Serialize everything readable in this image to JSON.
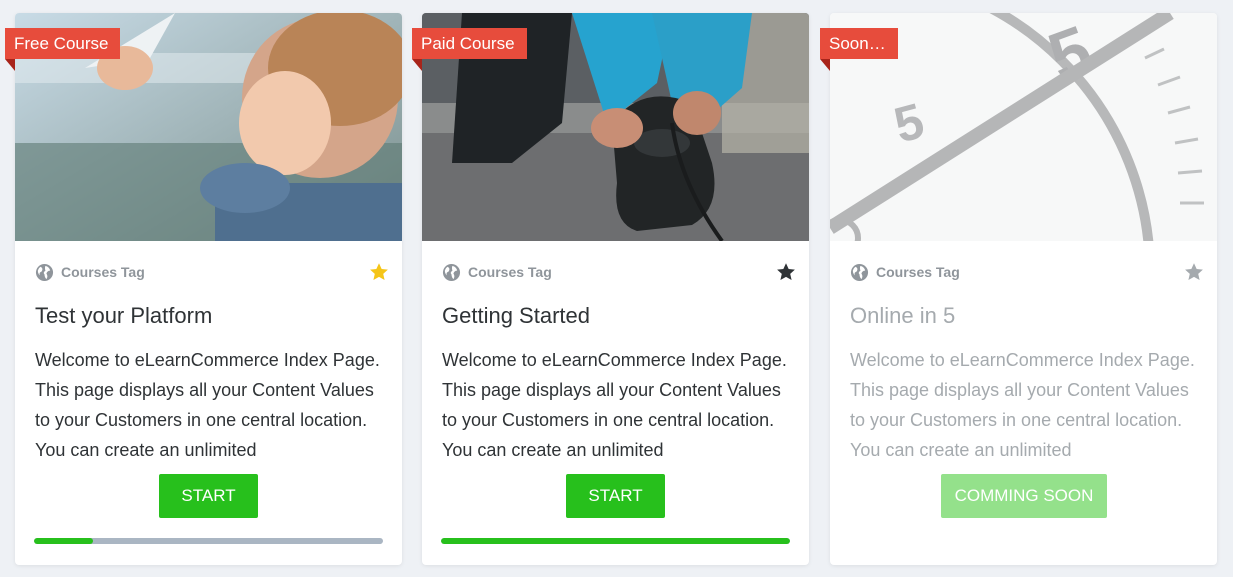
{
  "courses": [
    {
      "ribbon": "Free Course",
      "tag": "Courses Tag",
      "star_color": "#f5c518",
      "title": "Test your Platform",
      "description": "Welcome to eLearnCommerce Index Page. This page displays all your Content Values to your Customers in one central location. You can create an unlimited",
      "button": "START",
      "progress": 0.17,
      "disabled": false
    },
    {
      "ribbon": "Paid Course",
      "tag": "Courses Tag",
      "star_color": "#2f3336",
      "title": "Getting Started",
      "description": "Welcome to eLearnCommerce Index Page. This page displays all your Content Values to your Customers in one central location. You can create an unlimited",
      "button": "START",
      "progress": 1.0,
      "disabled": false
    },
    {
      "ribbon": "Soon…",
      "tag": "Courses Tag",
      "star_color": "#a5aaae",
      "title": "Online in 5",
      "description": "Welcome to eLearnCommerce Index Page. This page displays all your Content Values to your Customers in one central location. You can create an unlimited",
      "button": "COMMING SOON",
      "disabled": true
    }
  ],
  "colors": {
    "accent_green": "#27c01c",
    "ribbon_red": "#e74c3c",
    "progress_track": "#aab6c3"
  },
  "icons": [
    "globe-icon",
    "star-icon"
  ]
}
